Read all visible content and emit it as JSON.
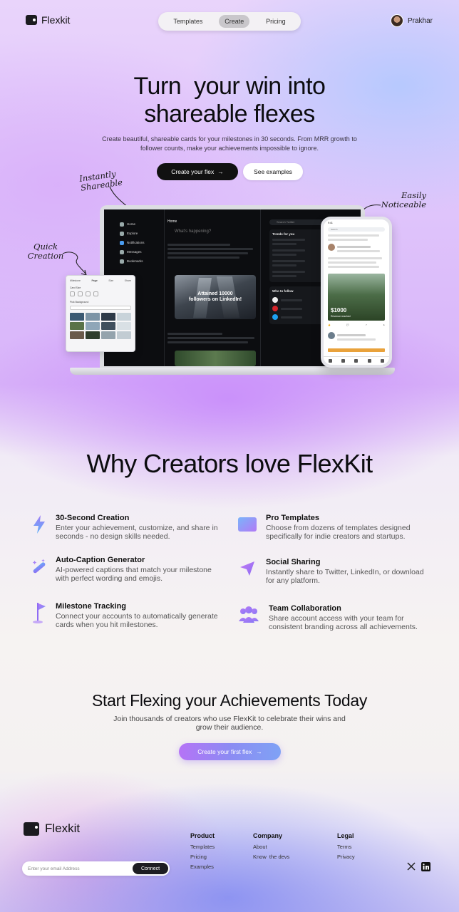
{
  "nav": {
    "brand": "Flexkit",
    "links": [
      "Templates",
      "Create",
      "Pricing"
    ],
    "active": "Create",
    "user_name": "Prakhar"
  },
  "hero": {
    "title_line1": "Turn  your win into",
    "title_line2": "shareable flexes",
    "subtitle": "Create beautiful, shareable cards for your milestones in 30 seconds. From MRR growth to follower counts, make your achievements impossible to ignore.",
    "primary_cta": "Create your flex",
    "secondary_cta": "See examples",
    "annotations": {
      "instantly": "Instantly Shareable",
      "easily": "Easily Noticeable",
      "quick": "Quick Creation"
    }
  },
  "mockup": {
    "twitter": {
      "nav": [
        "Home",
        "Explore",
        "Notifications",
        "Messages",
        "Bookmarks"
      ],
      "home": "Home",
      "compose": "What's happening?",
      "card_text": "Attained 10000 followers on LinkedIn!",
      "trends_title": "Trends for you",
      "follow_title": "Who to follow",
      "follow_button": "Follow",
      "search": "Search Twitter"
    },
    "panel": {
      "tabs": [
        "Milestone",
        "Page",
        "Size",
        "Share"
      ],
      "label1": "Card Size",
      "label2": "Pick Background"
    },
    "phone": {
      "search": "Search",
      "amount": "$1000",
      "caption": "Revenue reached"
    }
  },
  "why": {
    "title": "Why Creators love FlexKit",
    "features": [
      {
        "icon": "lightning-icon",
        "title": "30-Second Creation",
        "desc": "Enter your achievement, customize, and share in seconds - no design skills needed."
      },
      {
        "icon": "templates-icon",
        "title": "Pro Templates",
        "desc": "Choose from dozens of templates designed specifically for indie creators and startups."
      },
      {
        "icon": "magic-wand-icon",
        "title": "Auto-Caption Generator",
        "desc": "AI-powered captions that match your milestone with perfect wording and emojis."
      },
      {
        "icon": "send-icon",
        "title": "Social Sharing",
        "desc": "Instantly share to Twitter, LinkedIn, or download for any platform."
      },
      {
        "icon": "flag-icon",
        "title": "Milestone Tracking",
        "desc": "Connect your accounts to automatically generate cards when you hit milestones."
      },
      {
        "icon": "team-icon",
        "title": "Team Collaboration",
        "desc": "Share account access with your team for consistent branding across all achievements."
      }
    ]
  },
  "cta": {
    "title": "Start Flexing your Achievements Today",
    "subtitle": "Join thousands of creators who use FlexKit to celebrate their wins and grow their audience.",
    "button": "Create your first flex"
  },
  "footer": {
    "brand": "Flexkit",
    "email_placeholder": "Enter your email Address",
    "connect": "Connect",
    "columns": [
      {
        "title": "Product",
        "links": [
          "Templates",
          "Pricing",
          "Examples"
        ]
      },
      {
        "title": "Company",
        "links": [
          "About",
          "Know  the devs"
        ]
      },
      {
        "title": "Legal",
        "links": [
          "Terms",
          "Privacy"
        ]
      }
    ]
  },
  "colors": {
    "accent": "#a06cf5",
    "dark": "#111111"
  }
}
